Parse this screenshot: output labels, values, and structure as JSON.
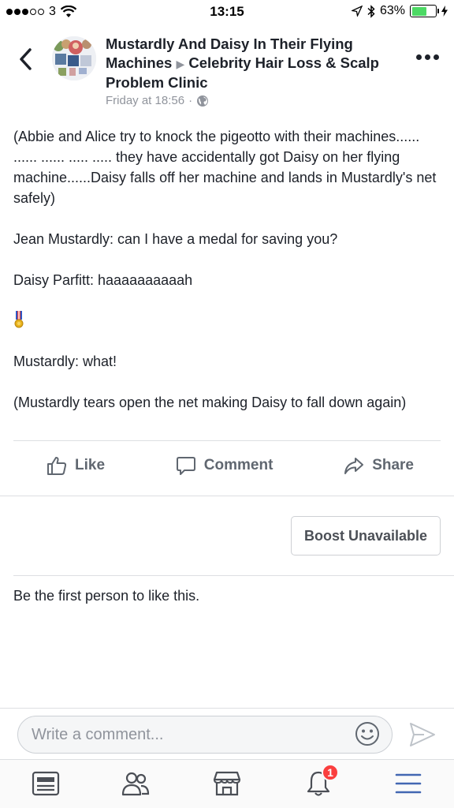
{
  "status_bar": {
    "carrier": "3",
    "time": "13:15",
    "battery_percent": "63%",
    "battery_level": 0.63,
    "colors": {
      "battery": "#4cd964"
    }
  },
  "post": {
    "page_name": "Mustardly And Daisy In Their Flying Machines",
    "group_name": "Celebrity Hair Loss & Scalp Problem Clinic",
    "timestamp": "Friday at 18:56",
    "separator": "·",
    "privacy_icon": "globe-icon",
    "paragraphs": [
      "(Abbie and Alice try to knock the pigeotto with their machines...... ...... ...... ..... ..... they have accidentally got Daisy on her flying machine......Daisy falls off her machine and lands in Mustardly's net safely)",
      "Jean Mustardly: can I have a medal for saving you?",
      "Daisy Parfitt: haaaaaaaaaah",
      "Mustardly: what!",
      "(Mustardly tears open the net making Daisy to fall down again)"
    ]
  },
  "actions": {
    "like_label": "Like",
    "comment_label": "Comment",
    "share_label": "Share"
  },
  "boost": {
    "label": "Boost Unavailable"
  },
  "likes_summary": "Be the first person to like this.",
  "comment_box": {
    "placeholder": "Write a comment..."
  },
  "tab_bar": {
    "tabs": [
      {
        "icon": "news-feed-icon"
      },
      {
        "icon": "friends-icon"
      },
      {
        "icon": "marketplace-icon"
      },
      {
        "icon": "notifications-icon",
        "badge": "1"
      },
      {
        "icon": "menu-icon",
        "active": true
      }
    ],
    "colors": {
      "active": "#4267b2",
      "inactive": "#4b4f56",
      "badge": "#fa3e3e"
    }
  }
}
